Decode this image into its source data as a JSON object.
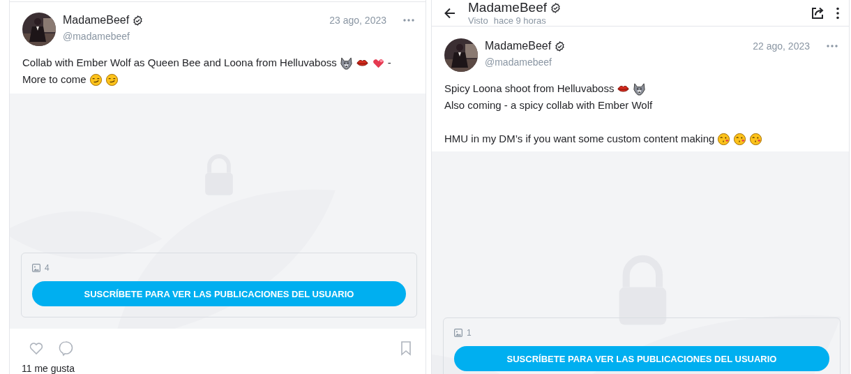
{
  "feed_post": {
    "name": "MadameBeef",
    "verified": true,
    "handle": "@madamebeef",
    "date": "23 ago, 2023",
    "paragraphs": [
      [
        [
          {
            "kind": "text",
            "text": "Collab with Ember Wolf as Queen Bee and Loona from Helluvaboss"
          },
          {
            "kind": "wolf"
          },
          {
            "kind": "lips"
          },
          {
            "kind": "hearts"
          },
          {
            "kind": "text",
            "text": "-"
          }
        ],
        [
          {
            "kind": "text",
            "text": "More to come"
          },
          {
            "kind": "smirk"
          },
          {
            "kind": "smirk"
          }
        ]
      ]
    ],
    "media_count": "4",
    "subscribe_label": "SUSCRÍBETE PARA VER LAS PUBLICACIONES DEL USUARIO",
    "liked": false,
    "bookmarked": false,
    "likes": "11 me gusta"
  },
  "chat_header": {
    "title": "MadameBeef",
    "verified": true,
    "status": "Visto",
    "last_seen": "hace 9 horas"
  },
  "chat_post": {
    "name": "MadameBeef",
    "verified": true,
    "handle": "@madamebeef",
    "date": "22 ago, 2023",
    "paragraphs": [
      [
        [
          {
            "kind": "text",
            "text": "Spicy Loona shoot from Helluvaboss"
          },
          {
            "kind": "lips"
          },
          {
            "kind": "wolf"
          }
        ],
        [
          {
            "kind": "text",
            "text": "Also coming - a spicy collab with Ember Wolf"
          }
        ]
      ],
      [
        [
          {
            "kind": "text",
            "text": "HMU in my DM’s if you want some custom content making"
          },
          {
            "kind": "kiss"
          },
          {
            "kind": "kiss"
          },
          {
            "kind": "kiss"
          }
        ]
      ]
    ],
    "media_count": "1",
    "subscribe_label": "SUSCRÍBETE PARA VER LAS PUBLICACIONES DEL USUARIO"
  }
}
